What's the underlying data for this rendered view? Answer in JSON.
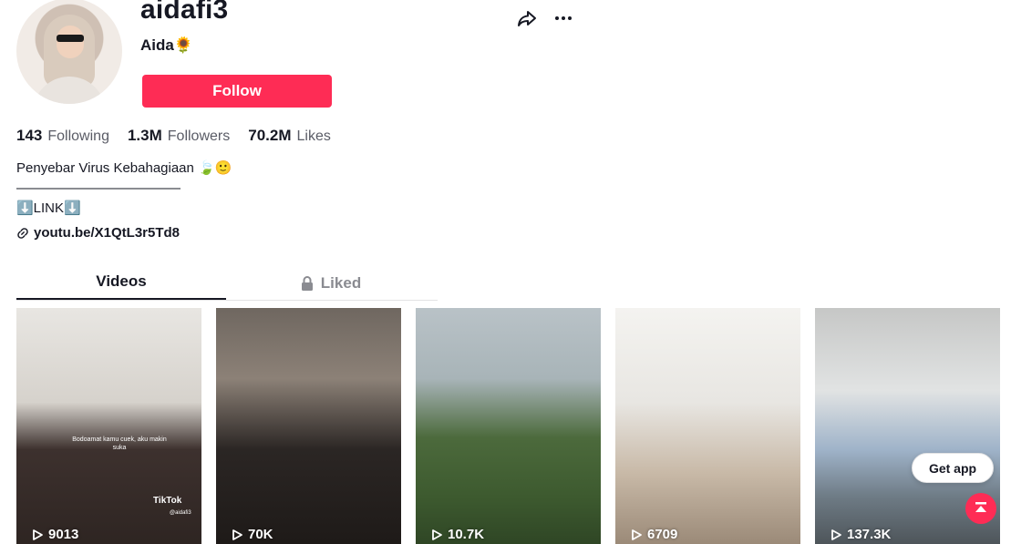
{
  "profile": {
    "username": "aidafi3",
    "nickname": "Aida🌻",
    "follow_label": "Follow"
  },
  "stats": [
    {
      "value": "143",
      "label": "Following"
    },
    {
      "value": "1.3M",
      "label": "Followers"
    },
    {
      "value": "70.2M",
      "label": "Likes"
    }
  ],
  "bio": {
    "line1": "Penyebar Virus Kebahagiaan 🍃🙂",
    "line2": "————————————",
    "line3": "⬇️LINK⬇️"
  },
  "link": {
    "text": "youtu.be/X1QtL3r5Td8"
  },
  "tabs": {
    "videos": "Videos",
    "liked": "Liked"
  },
  "videos": [
    {
      "views": "9013",
      "overlay_text": "Bodoamat kamu cuek, aku makin suka",
      "watermark": "TikTok",
      "watermark_handle": "@aidafi3"
    },
    {
      "views": "70K"
    },
    {
      "views": "10.7K"
    },
    {
      "views": "6709"
    },
    {
      "views": "137.3K"
    }
  ],
  "get_app_label": "Get app",
  "colors": {
    "accent": "#fe2c55",
    "text": "#161823",
    "muted": "#8a8b91"
  },
  "icons": [
    "share-icon",
    "more-icon",
    "link-icon",
    "lock-icon",
    "play-icon",
    "back-to-top-icon"
  ]
}
